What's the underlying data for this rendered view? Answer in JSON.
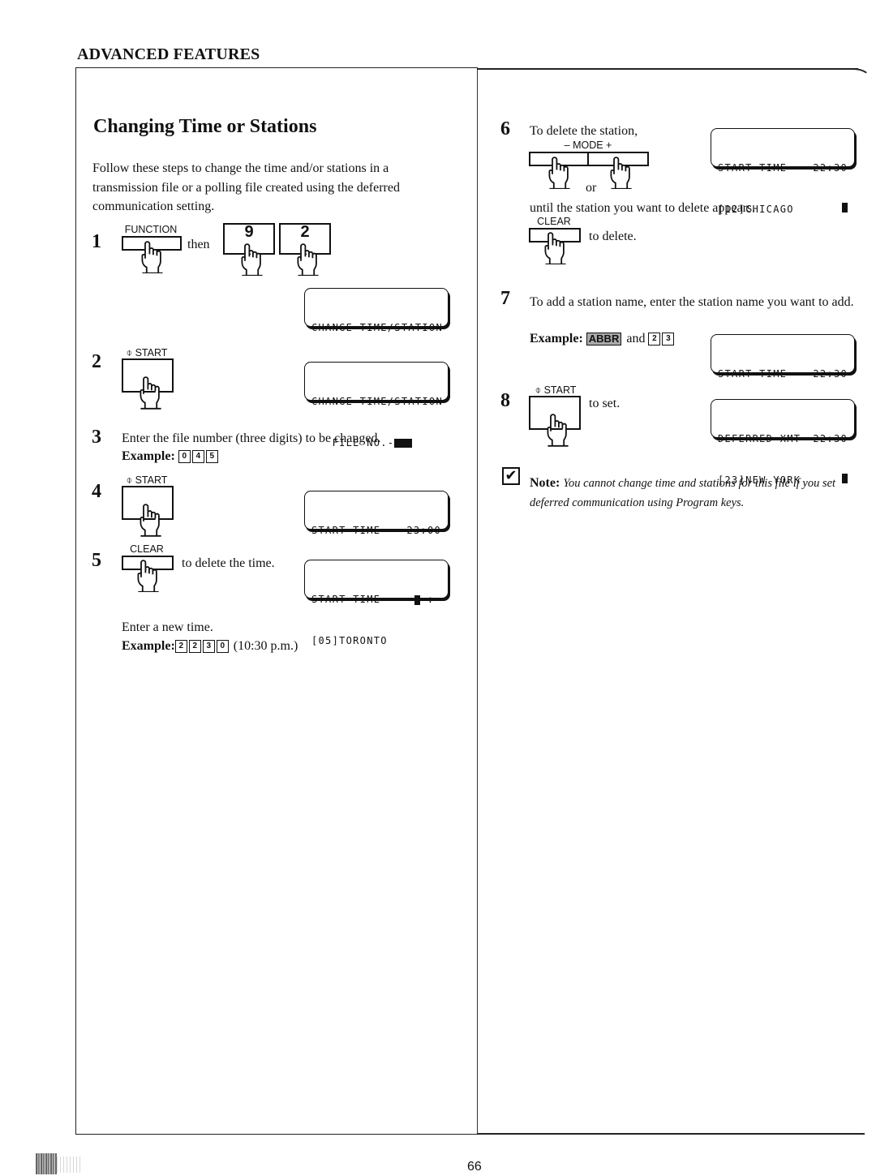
{
  "section_header": "ADVANCED FEATURES",
  "title": "Changing Time or Stations",
  "intro": "Follow these steps to change the time and/or stations in a transmission file or a polling file created using the deferred communication setting.",
  "steps": {
    "s1": {
      "num": "1",
      "key_label": "FUNCTION",
      "then": "then",
      "key1": "9",
      "key2": "2",
      "lcd": {
        "line1": "CHANGE TIME/STATION",
        "line2": ""
      }
    },
    "s2": {
      "num": "2",
      "key_label": "⌽ START",
      "lcd": {
        "line1": "CHANGE TIME/STATION",
        "line2": "   FILE NO.-"
      }
    },
    "s3": {
      "num": "3",
      "text": "Enter the file number (three digits) to be changed.",
      "example_label": "Example:",
      "example_keys": [
        "0",
        "4",
        "5"
      ]
    },
    "s4": {
      "num": "4",
      "key_label": "⌽ START",
      "lcd": {
        "line1_left": "START TIME",
        "line1_right": "23:00",
        "line2": "[05]TORONTO"
      }
    },
    "s5": {
      "num": "5",
      "key_label": "CLEAR",
      "text": "to delete the time.",
      "lcd": {
        "line1_left": "START TIME",
        "line1_right": " :",
        "line2": "[05]TORONTO"
      },
      "enter": "Enter a new time.",
      "example_label": "Example:",
      "example_keys": [
        "2",
        "2",
        "3",
        "0"
      ],
      "example_note": "(10:30 p.m.)"
    },
    "s6": {
      "num": "6",
      "text": "To delete the station,",
      "mode_label": "–  MODE  +",
      "or": "or",
      "text2": "until the station you want to delete appears.",
      "clear_label": "CLEAR",
      "text3": "to delete.",
      "lcd": {
        "line1_left": "START TIME",
        "line1_right": "22:30",
        "line2": "[12]CHICAGO"
      }
    },
    "s7": {
      "num": "7",
      "text": "To add a station name, enter the station name you want to add.",
      "example_label": "Example:",
      "abbr_key": "ABBR",
      "and": "and",
      "example_keys": [
        "2",
        "3"
      ],
      "lcd": {
        "line1_left": "START TIME",
        "line1_right": "22:30",
        "line2": "[23]NEW YORK"
      }
    },
    "s8": {
      "num": "8",
      "key_label": "⌽ START",
      "text": "to set.",
      "lcd": {
        "line1_left": "DEFERRED XMT",
        "line1_right": "22:30",
        "line2": "[23]NEW YORK"
      }
    }
  },
  "note": {
    "icon": "check-icon",
    "label": "Note:",
    "text": "You cannot change time and stations for this file if you set deferred communication using Program keys."
  },
  "page_number": "66"
}
